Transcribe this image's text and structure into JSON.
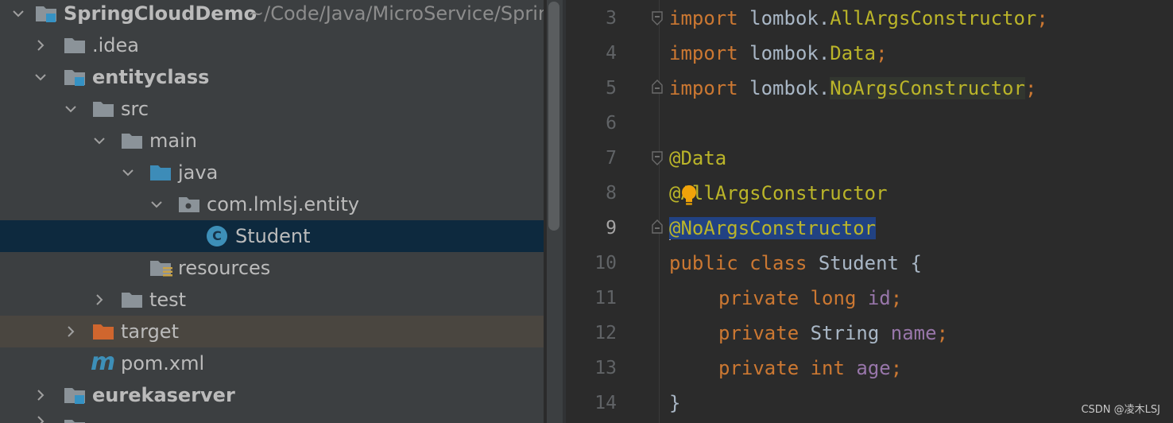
{
  "colors": {
    "panel_bg": "#3c3f41",
    "editor_bg": "#2b2b2b",
    "selection_bg": "#0d293e",
    "excluded_bg": "#4a4640",
    "keyword": "#cc7832",
    "annotation": "#bbb529",
    "field": "#9876aa",
    "plain_code": "#a9b7c6",
    "line_number": "#606366"
  },
  "tree": {
    "root": {
      "name": "SpringCloudDemo",
      "path": "~/Code/Java/MicroService/Spring",
      "icon": "module-folder-icon"
    },
    "idea": {
      "name": ".idea",
      "icon": "folder-icon"
    },
    "entityclass": {
      "name": "entityclass",
      "icon": "module-folder-icon"
    },
    "src": {
      "name": "src",
      "icon": "folder-icon"
    },
    "main": {
      "name": "main",
      "icon": "folder-icon"
    },
    "java": {
      "name": "java",
      "icon": "source-folder-icon"
    },
    "package": {
      "name": "com.lmlsj.entity",
      "icon": "package-icon"
    },
    "student": {
      "name": "Student",
      "icon": "class-icon",
      "class_letter": "C"
    },
    "resources": {
      "name": "resources",
      "icon": "resources-folder-icon"
    },
    "test": {
      "name": "test",
      "icon": "folder-icon"
    },
    "target": {
      "name": "target",
      "icon": "excluded-folder-icon"
    },
    "pom": {
      "name": "pom.xml",
      "icon": "maven-icon",
      "maven_letter": "m"
    },
    "eurekaserver": {
      "name": "eurekaserver",
      "icon": "module-folder-icon"
    }
  },
  "editor": {
    "line_numbers": [
      "3",
      "4",
      "5",
      "6",
      "7",
      "8",
      "9",
      "10",
      "11",
      "12",
      "13",
      "14"
    ],
    "current_line": "9",
    "code": {
      "l3": {
        "kw": "import",
        "pkg": " lombok.",
        "cls": "AllArgsConstructor",
        "semi": ";"
      },
      "l4": {
        "kw": "import",
        "pkg": " lombok.",
        "cls": "Data",
        "semi": ";"
      },
      "l5": {
        "kw": "import",
        "pkg": " lombok.",
        "cls": "NoArgsConstructor",
        "semi": ";"
      },
      "l7": {
        "ann": "@Data"
      },
      "l8": {
        "ann": "@AllArgsConstructor"
      },
      "l9": {
        "ann": "@NoArgsConstructor"
      },
      "l10": {
        "kw1": "public",
        "kw2": " class",
        "name": " Student {"
      },
      "l11": {
        "kw": "private",
        "type": " long",
        "field": " id",
        "semi": ";"
      },
      "l12": {
        "kw": "private",
        "type": " String",
        "field": " name",
        "semi": ";"
      },
      "l13": {
        "kw": "private",
        "type": " int",
        "field": " age",
        "semi": ";"
      },
      "l14": {
        "text": "}"
      }
    }
  },
  "watermark": "CSDN @凌木LSJ"
}
